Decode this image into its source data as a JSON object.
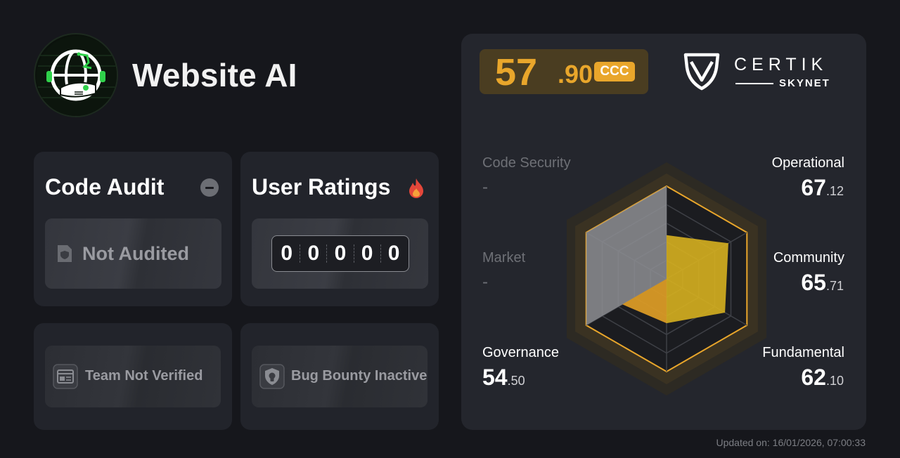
{
  "project": {
    "name": "Website AI",
    "logo_icon": "globe-robot-icon"
  },
  "code_audit": {
    "title": "Code Audit",
    "status_badge_icon": "minus-circle-icon",
    "status": "Not Audited",
    "status_icon": "shield-document-icon"
  },
  "user_ratings": {
    "title": "User Ratings",
    "title_icon": "fire-icon",
    "digits": [
      "0",
      "0",
      "0",
      "0",
      "0"
    ]
  },
  "team": {
    "label": "Team Not Verified",
    "icon": "id-card-icon"
  },
  "bug_bounty": {
    "label": "Bug Bounty Inactive",
    "icon": "bug-shield-icon"
  },
  "score": {
    "integer": "57",
    "decimal": ".90",
    "grade": "CCC",
    "accent_color": "#e9a62b"
  },
  "brand": {
    "name": "CERTIK",
    "sub": "SKYNET",
    "logo_icon": "certik-shield-icon"
  },
  "metrics": {
    "code_security": {
      "label": "Code Security",
      "value": "-"
    },
    "operational": {
      "label": "Operational",
      "int": "67",
      "dec": ".12"
    },
    "market": {
      "label": "Market",
      "value": "-"
    },
    "community": {
      "label": "Community",
      "int": "65",
      "dec": ".71"
    },
    "governance": {
      "label": "Governance",
      "int": "54",
      "dec": ".50"
    },
    "fundamental": {
      "label": "Fundamental",
      "int": "62",
      "dec": ".10"
    }
  },
  "chart_data": {
    "type": "radar",
    "axes": [
      "Operational",
      "Community",
      "Fundamental",
      "Governance",
      "Market",
      "Code Security"
    ],
    "values": [
      67.12,
      65.71,
      62.1,
      54.5,
      null,
      null
    ],
    "range": [
      0,
      100
    ]
  },
  "updated": "Updated on: 16/01/2026, 07:00:33"
}
